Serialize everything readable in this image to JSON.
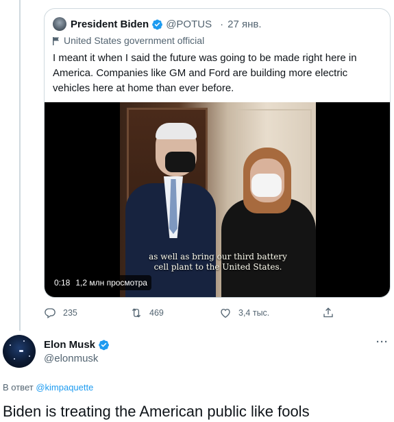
{
  "quoted_tweet": {
    "author_name": "President Biden",
    "author_handle": "@POTUS",
    "separator": "·",
    "date": "27 янв.",
    "label": "United States government official",
    "text": "I meant it when I said the future was going to be made right here in America. Companies like GM and Ford are building more electric vehicles here at home than ever before.",
    "video": {
      "caption_line1": "as well as bring our third battery",
      "caption_line2": "cell plant to the United States.",
      "timestamp": "0:18",
      "views": "1,2 млн просмотра"
    }
  },
  "actions": {
    "replies": "235",
    "retweets": "469",
    "likes": "3,4 тыс."
  },
  "reply_tweet": {
    "author_name": "Elon Musk",
    "author_handle": "@elonmusk",
    "more_label": "···",
    "replying_prefix": "В ответ",
    "replying_to": "@kimpaquette",
    "text": "Biden is treating the American public like fools"
  },
  "colors": {
    "verified": "#1d9bf0",
    "secondary_text": "#536471",
    "link": "#1d9bf0",
    "border": "#cfd9de"
  },
  "icons": [
    "verified-badge-icon",
    "flag-icon",
    "reply-icon",
    "retweet-icon",
    "like-icon",
    "share-icon",
    "more-icon"
  ]
}
